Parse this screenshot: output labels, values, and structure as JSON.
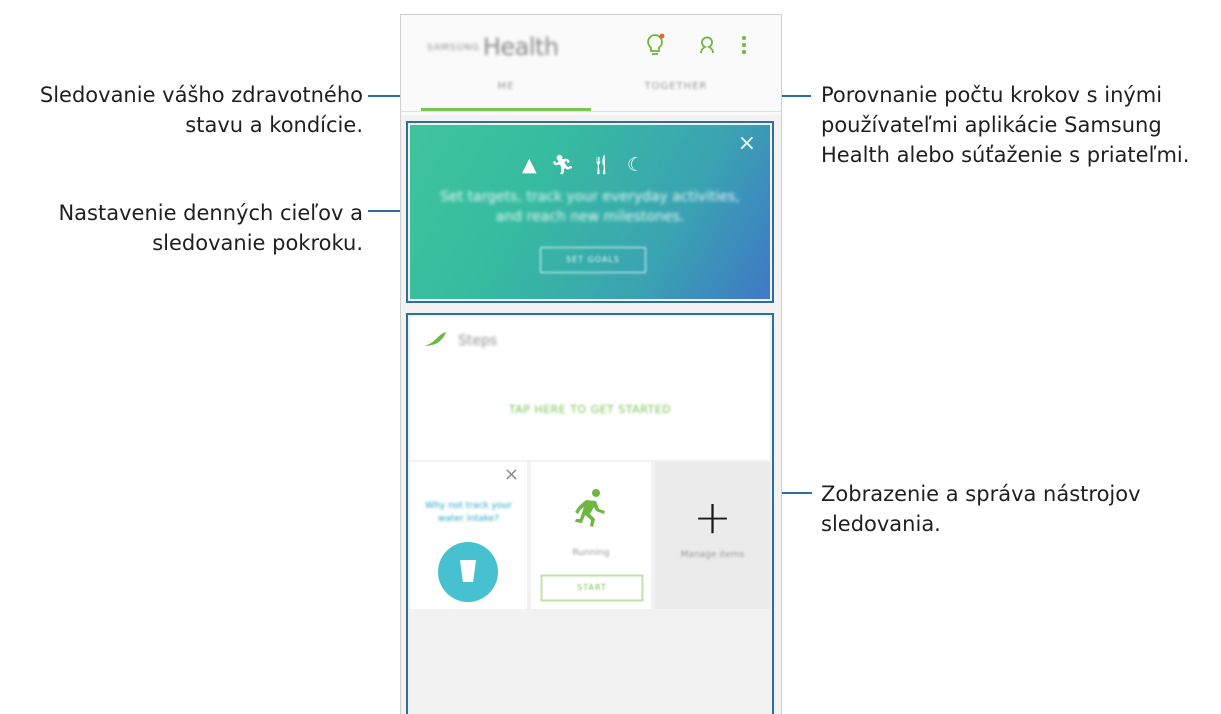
{
  "callouts": {
    "me_tab": {
      "line1": "Sledovanie vášho zdravotného",
      "line2": "stavu a kondície."
    },
    "goals": {
      "line1": "Nastavenie denných cieľov a",
      "line2": "sledovanie pokroku."
    },
    "together_tab": {
      "line1": "Porovnanie počtu krokov s inými",
      "line2": "používateľmi aplikácie Samsung",
      "line3": "Health alebo súťaženie s priateľmi."
    },
    "trackers": {
      "line1": "Zobrazenie a správa nástrojov",
      "line2": "sledovania."
    }
  },
  "app": {
    "brand": "SAMSUNG",
    "title": "Health",
    "icons": [
      "lightbulb-icon",
      "profile-icon",
      "more-icon"
    ],
    "tabs": [
      {
        "label": "ME"
      },
      {
        "label": "TOGETHER"
      }
    ],
    "accent_color": "#7dc355"
  },
  "banner": {
    "text": "Set targets, track your everyday activities, and reach new milestones.",
    "button": "SET GOALS",
    "close": "×"
  },
  "steps": {
    "label": "Steps",
    "cta": "TAP HERE TO GET STARTED"
  },
  "tiles": {
    "water": {
      "text": "Why not track your water intake?",
      "close": "×"
    },
    "running": {
      "label": "Running",
      "button": "START"
    },
    "manage": {
      "plus": "+",
      "label": "Manage items"
    }
  }
}
